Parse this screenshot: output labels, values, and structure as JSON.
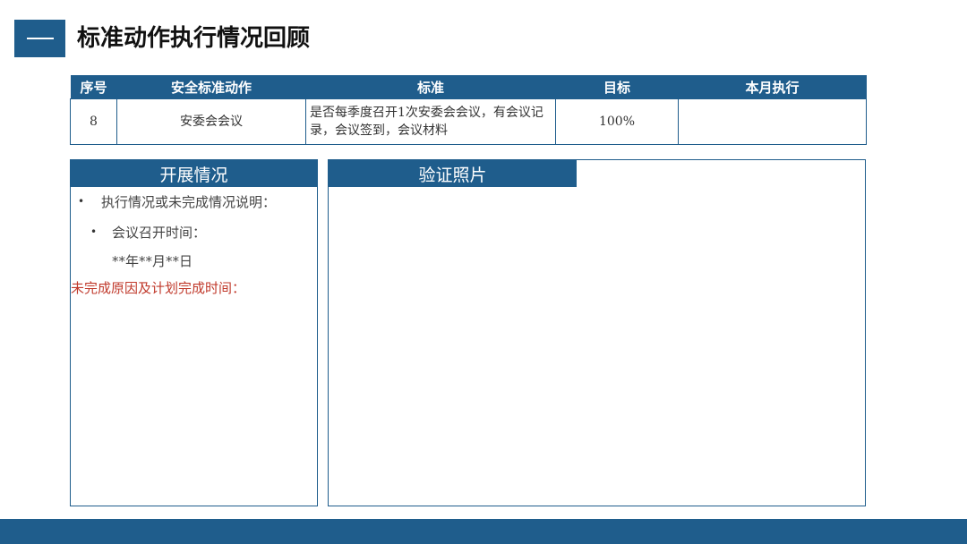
{
  "header": {
    "title": "标准动作执行情况回顾"
  },
  "table": {
    "columns": [
      "序号",
      "安全标准动作",
      "标准",
      "目标",
      "本月执行"
    ],
    "rows": [
      {
        "no": "8",
        "action": "安委会会议",
        "standard": "是否每季度召开1次安委会会议，有会议记录，会议签到，会议材料",
        "target": "100%",
        "execution": ""
      }
    ]
  },
  "progress_panel": {
    "title": "开展情况",
    "items": [
      "执行情况或未完成情况说明：",
      "会议召开时间：",
      "**年**月**日",
      "未完成原因及计划完成时间："
    ]
  },
  "photo_panel": {
    "title": "验证照片"
  },
  "colors": {
    "primary": "#1f5d8c",
    "alert": "#c0392b"
  }
}
